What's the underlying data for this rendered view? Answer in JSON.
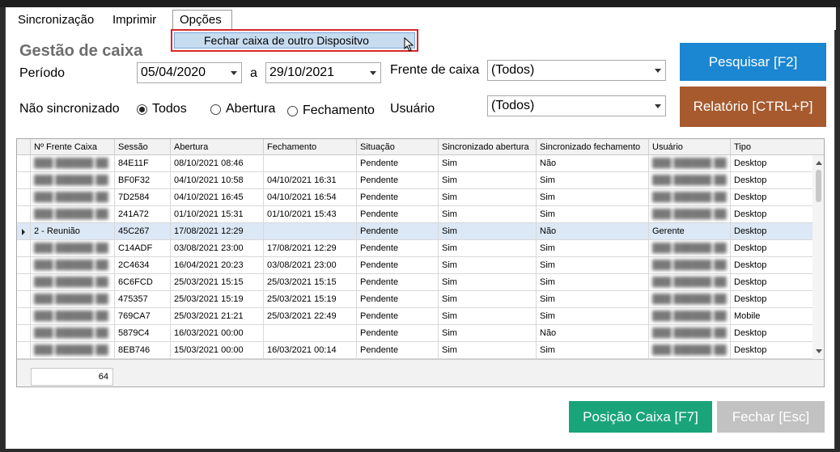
{
  "menu": {
    "items": [
      "Sincronização",
      "Imprimir",
      "Opções"
    ]
  },
  "dropdown": {
    "item": "Fechar caixa de outro Dispositvo"
  },
  "title": "Gestão de caixa",
  "filters": {
    "periodo_label": "Período",
    "date_from": "05/04/2020",
    "date_sep": "a",
    "date_to": "29/10/2021",
    "frente_label": "Frente de caixa",
    "frente_value": "(Todos)",
    "nao_sinc_label": "Não sincronizado",
    "radios": [
      "Todos",
      "Abertura",
      "Fechamento"
    ],
    "usuario_label": "Usuário",
    "usuario_value": "(Todos)"
  },
  "buttons": {
    "pesquisar": "Pesquisar [F2]",
    "relatorio": "Relatório [CTRL+P]",
    "posicao": "Posição Caixa [F7]",
    "fechar": "Fechar [Esc]"
  },
  "colors": {
    "blue": "#1b86d1",
    "brown": "#a65a2e",
    "green": "#1aa47a",
    "gray": "#c2c2c2",
    "menu_highlight_border": "#d62828"
  },
  "grid": {
    "columns": [
      "Nº Frente Caixa",
      "Sessão",
      "Abertura",
      "Fechamento",
      "Situação",
      "Sincronizado abertura",
      "Sincronizado fechamento",
      "Usuário",
      "Tipo"
    ],
    "rows": [
      {
        "frente": "",
        "sessao": "84E11F",
        "abertura": "08/10/2021  08:46",
        "fechamento": "",
        "situacao": "Pendente",
        "sinc_ab": "Sim",
        "sinc_fe": "Não",
        "usuario": "",
        "tipo": "Desktop"
      },
      {
        "frente": "",
        "sessao": "BF0F32",
        "abertura": "04/10/2021  10:58",
        "fechamento": "04/10/2021  16:31",
        "situacao": "Pendente",
        "sinc_ab": "Sim",
        "sinc_fe": "Sim",
        "usuario": "",
        "tipo": "Desktop"
      },
      {
        "frente": "",
        "sessao": "7D2584",
        "abertura": "04/10/2021  16:45",
        "fechamento": "04/10/2021  16:54",
        "situacao": "Pendente",
        "sinc_ab": "Sim",
        "sinc_fe": "Sim",
        "usuario": "",
        "tipo": "Desktop"
      },
      {
        "frente": "",
        "sessao": "241A72",
        "abertura": "01/10/2021  15:31",
        "fechamento": "01/10/2021  15:43",
        "situacao": "Pendente",
        "sinc_ab": "Sim",
        "sinc_fe": "Sim",
        "usuario": "",
        "tipo": "Desktop"
      },
      {
        "frente": "2 - Reunião",
        "sessao": "45C267",
        "abertura": "17/08/2021  12:29",
        "fechamento": "",
        "situacao": "Pendente",
        "sinc_ab": "Sim",
        "sinc_fe": "Não",
        "usuario": "Gerente",
        "tipo": "Desktop"
      },
      {
        "frente": "",
        "sessao": "C14ADF",
        "abertura": "03/08/2021  23:00",
        "fechamento": "17/08/2021  12:29",
        "situacao": "Pendente",
        "sinc_ab": "Sim",
        "sinc_fe": "Sim",
        "usuario": "",
        "tipo": "Desktop"
      },
      {
        "frente": "",
        "sessao": "2C4634",
        "abertura": "16/04/2021  20:23",
        "fechamento": "03/08/2021  23:00",
        "situacao": "Pendente",
        "sinc_ab": "Sim",
        "sinc_fe": "Sim",
        "usuario": "",
        "tipo": "Desktop"
      },
      {
        "frente": "",
        "sessao": "6C6FCD",
        "abertura": "25/03/2021  15:15",
        "fechamento": "25/03/2021  15:15",
        "situacao": "Pendente",
        "sinc_ab": "Sim",
        "sinc_fe": "Sim",
        "usuario": "",
        "tipo": "Desktop"
      },
      {
        "frente": "",
        "sessao": "475357",
        "abertura": "25/03/2021  15:19",
        "fechamento": "25/03/2021  15:19",
        "situacao": "Pendente",
        "sinc_ab": "Sim",
        "sinc_fe": "Sim",
        "usuario": "",
        "tipo": "Desktop"
      },
      {
        "frente": "",
        "sessao": "769CA7",
        "abertura": "25/03/2021  21:21",
        "fechamento": "25/03/2021  22:49",
        "situacao": "Pendente",
        "sinc_ab": "Sim",
        "sinc_fe": "Sim",
        "usuario": "",
        "tipo": "Mobile"
      },
      {
        "frente": "",
        "sessao": "5879C4",
        "abertura": "16/03/2021  00:00",
        "fechamento": "",
        "situacao": "Pendente",
        "sinc_ab": "Sim",
        "sinc_fe": "Não",
        "usuario": "",
        "tipo": "Desktop"
      },
      {
        "frente": "",
        "sessao": "8EB746",
        "abertura": "15/03/2021  00:00",
        "fechamento": "16/03/2021  00:14",
        "situacao": "Pendente",
        "sinc_ab": "Sim",
        "sinc_fe": "Sim",
        "usuario": "",
        "tipo": "Desktop"
      }
    ],
    "selected_row": 4,
    "count": "64"
  }
}
